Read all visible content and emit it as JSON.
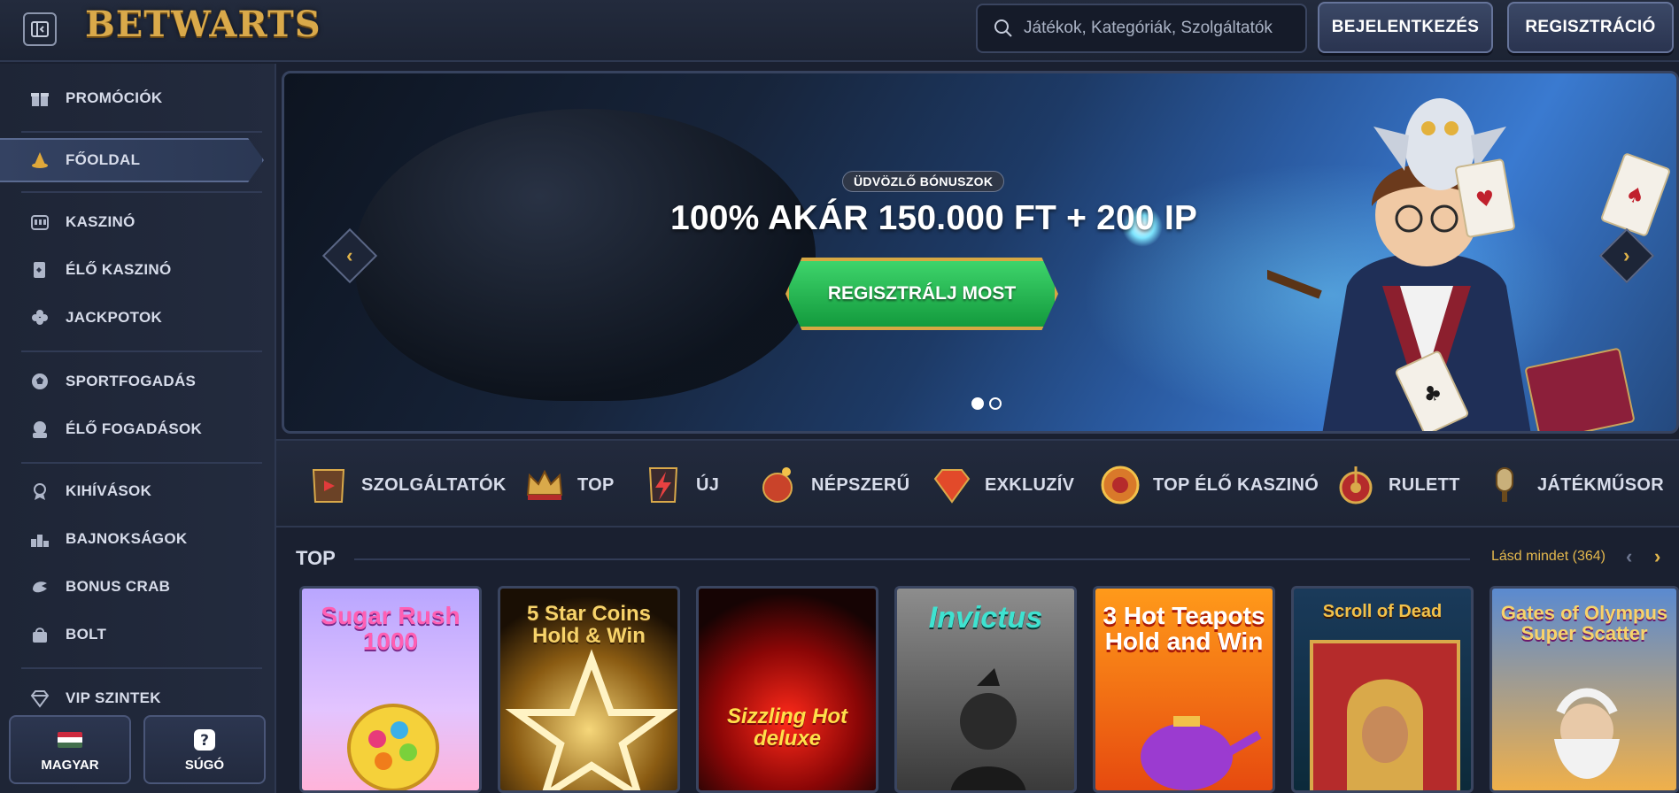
{
  "header": {
    "logo": "BETWARTS",
    "search_placeholder": "Játékok, Kategóriák, Szolgáltatók",
    "login_label": "BEJELENTKEZÉS",
    "register_label": "REGISZTRÁCIÓ"
  },
  "sidebar": {
    "items": [
      {
        "label": "PROMÓCIÓK",
        "icon": "gift-icon"
      },
      {
        "label": "FŐOLDAL",
        "icon": "wizard-hat-icon"
      },
      {
        "label": "KASZINÓ",
        "icon": "slot-machine-icon"
      },
      {
        "label": "ÉLŐ KASZINÓ",
        "icon": "live-cards-icon"
      },
      {
        "label": "JACKPOTOK",
        "icon": "clover-icon"
      },
      {
        "label": "SPORTFOGADÁS",
        "icon": "soccer-ball-icon"
      },
      {
        "label": "ÉLŐ FOGADÁSOK",
        "icon": "live-betting-icon"
      },
      {
        "label": "KIHÍVÁSOK",
        "icon": "medal-icon"
      },
      {
        "label": "BAJNOKSÁGOK",
        "icon": "podium-icon"
      },
      {
        "label": "BONUS CRAB",
        "icon": "crab-claw-icon"
      },
      {
        "label": "BOLT",
        "icon": "shopping-bag-icon"
      },
      {
        "label": "VIP SZINTEK",
        "icon": "diamond-icon"
      }
    ],
    "language_label": "MAGYAR",
    "help_label": "SÚGÓ"
  },
  "banner": {
    "badge": "ÜDVÖZLŐ BÓNUSZOK",
    "headline": "100% AKÁR 150.000 FT + 200 IP",
    "cta_label": "REGISZTRÁLJ MOST",
    "slide_count": 2,
    "active_slide": 1
  },
  "categories": [
    {
      "label": "SZOLGÁLTATÓK",
      "icon": "book-icon"
    },
    {
      "label": "TOP",
      "icon": "crown-icon"
    },
    {
      "label": "ÚJ",
      "icon": "lightning-icon"
    },
    {
      "label": "NÉPSZERŰ",
      "icon": "bomb-icon"
    },
    {
      "label": "EXKLUZÍV",
      "icon": "gem-icon"
    },
    {
      "label": "TOP ÉLŐ KASZINÓ",
      "icon": "roulette-chip-icon"
    },
    {
      "label": "RULETT",
      "icon": "roulette-wheel-icon"
    },
    {
      "label": "JÁTÉKMŰSOR",
      "icon": "microphone-icon"
    }
  ],
  "top_section": {
    "title": "TOP",
    "see_all": "Lásd mindet (364)",
    "games": [
      {
        "title": "Sugar Rush 1000"
      },
      {
        "title": "5 Star Coins Hold & Win"
      },
      {
        "title": "Sizzling Hot deluxe"
      },
      {
        "title": "Invictus"
      },
      {
        "title": "3 Hot Teapots Hold and Win"
      },
      {
        "title": "Scroll of Dead"
      },
      {
        "title": "Gates of Olympus Super Scatter"
      }
    ]
  },
  "colors": {
    "accent_gold": "#e4b84d",
    "cta_green": "#23b34f",
    "background": "#1a2030"
  }
}
